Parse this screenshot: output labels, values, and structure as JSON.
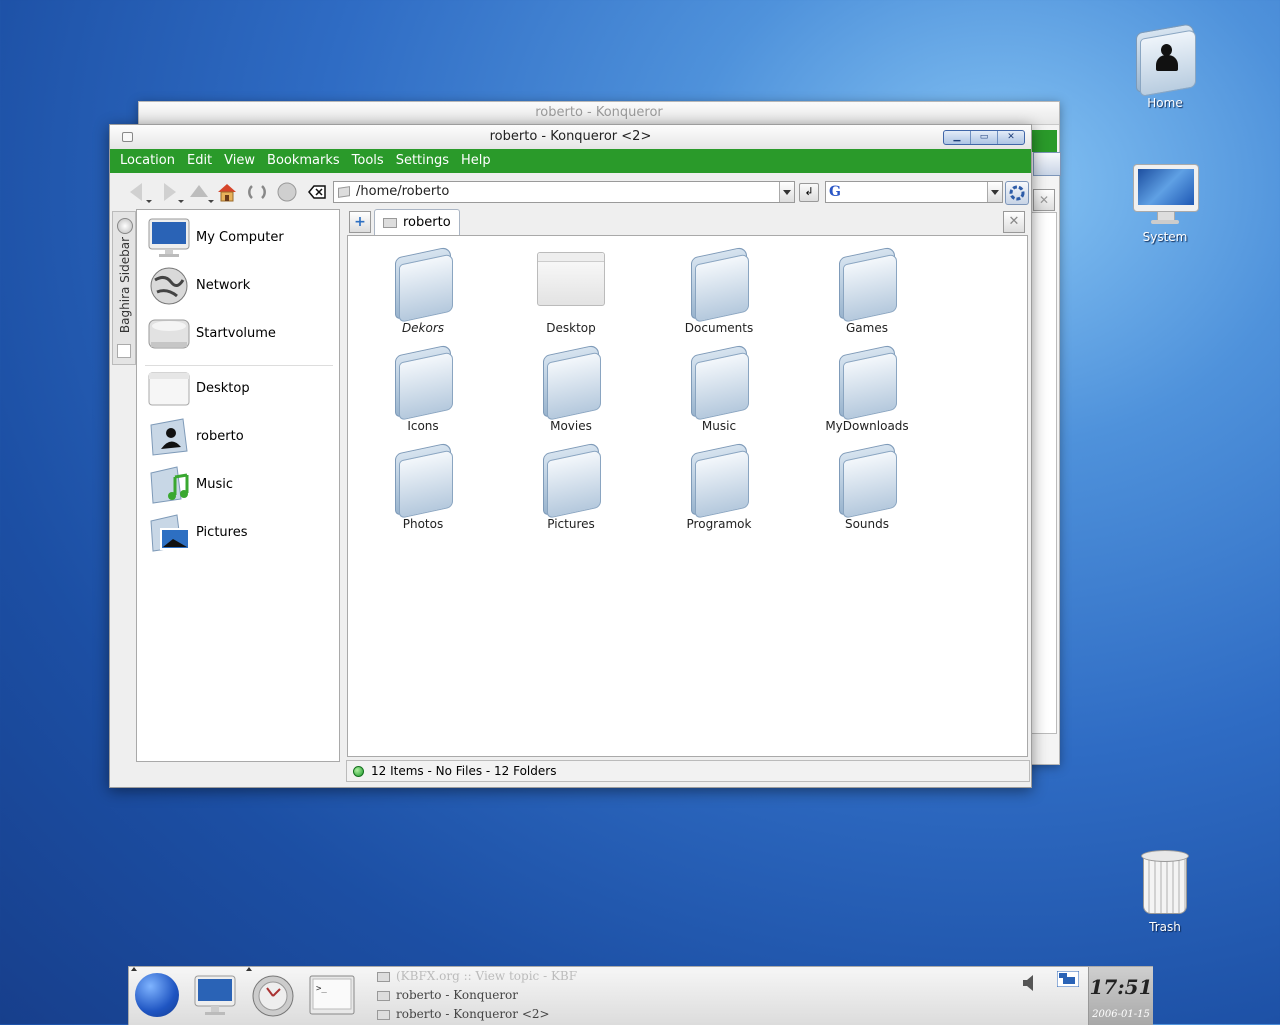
{
  "desktop": {
    "icons": [
      {
        "label": "Home",
        "icon": "home-folder-icon"
      },
      {
        "label": "System",
        "icon": "computer-icon"
      },
      {
        "label": "Trash",
        "icon": "trash-icon"
      }
    ]
  },
  "back_window": {
    "title": "roberto - Konqueror"
  },
  "window": {
    "title": "roberto - Konqueror <2>",
    "menu": [
      "Location",
      "Edit",
      "View",
      "Bookmarks",
      "Tools",
      "Settings",
      "Help"
    ],
    "location": "/home/roberto",
    "search_engine_glyph": "G",
    "sidebar_label": "Baghira Sidebar",
    "sidebar_devices": [
      {
        "label": "My Computer",
        "icon": "computer-icon"
      },
      {
        "label": "Network",
        "icon": "globe-icon"
      },
      {
        "label": "Startvolume",
        "icon": "hard-drive-icon"
      }
    ],
    "sidebar_places": [
      {
        "label": "Desktop",
        "icon": "desktop-window-icon"
      },
      {
        "label": "roberto",
        "icon": "home-folder-icon"
      },
      {
        "label": "Music",
        "icon": "music-folder-icon"
      },
      {
        "label": "Pictures",
        "icon": "pictures-folder-icon"
      }
    ],
    "tab_label": "roberto",
    "files": [
      {
        "name": "Dekors",
        "icon": "folder-icon",
        "italic": true
      },
      {
        "name": "Desktop",
        "icon": "desktop-window-icon"
      },
      {
        "name": "Documents",
        "icon": "folder-icon"
      },
      {
        "name": "Games",
        "icon": "folder-icon"
      },
      {
        "name": "Icons",
        "icon": "folder-icon"
      },
      {
        "name": "Movies",
        "icon": "folder-icon"
      },
      {
        "name": "Music",
        "icon": "folder-icon"
      },
      {
        "name": "MyDownloads",
        "icon": "folder-icon"
      },
      {
        "name": "Photos",
        "icon": "folder-icon"
      },
      {
        "name": "Pictures",
        "icon": "folder-icon"
      },
      {
        "name": "Programok",
        "icon": "folder-icon"
      },
      {
        "name": "Sounds",
        "icon": "folder-icon"
      }
    ],
    "status": "12 Items - No Files - 12 Folders"
  },
  "taskbar": {
    "tasks": [
      "(KBFX.org :: View topic - KBF",
      "roberto - Konqueror",
      "roberto - Konqueror <2>"
    ],
    "clock": "17:51",
    "date": "2006-01-15"
  },
  "colors": {
    "menubar": "#2a9a2a",
    "desktop": "#2f6cc4"
  }
}
